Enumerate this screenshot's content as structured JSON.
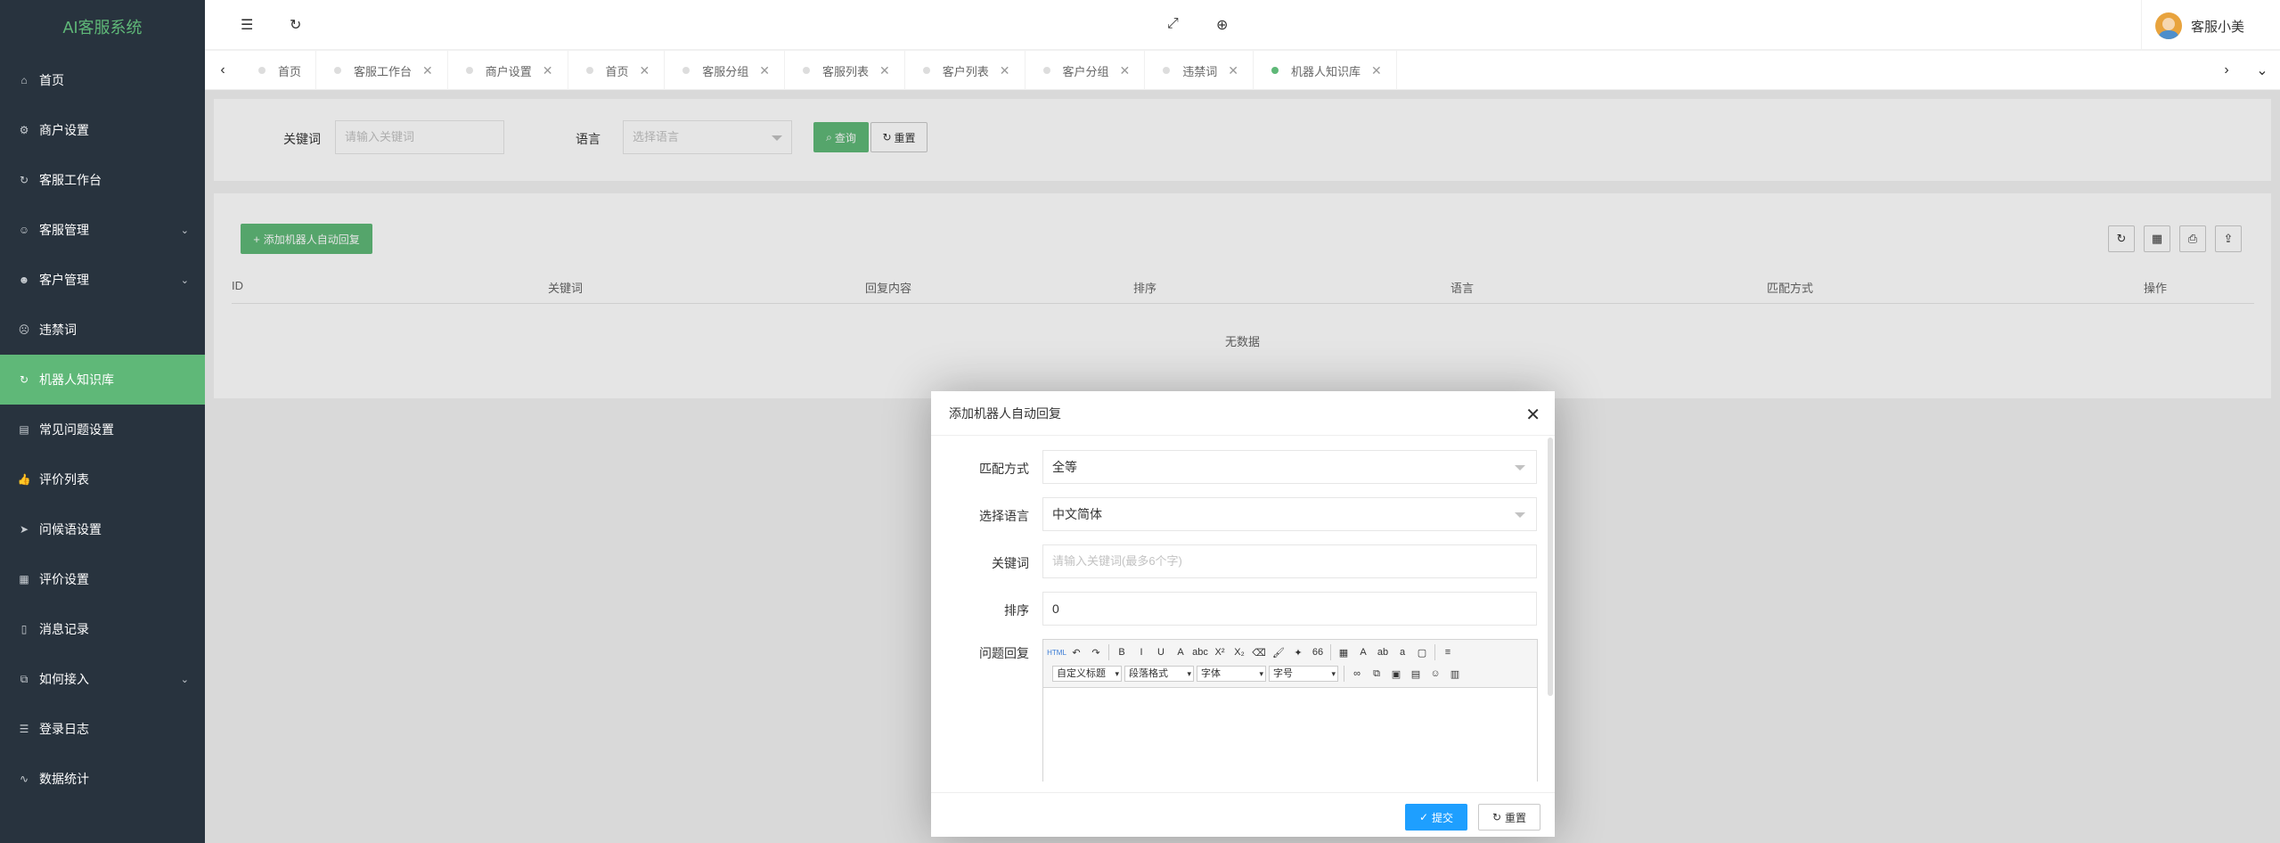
{
  "app": {
    "title": "AI客服系统"
  },
  "sidebar": {
    "items": [
      {
        "label": "首页",
        "icon": "home-icon",
        "glyph": "⌂",
        "expandable": false,
        "active": false
      },
      {
        "label": "商户设置",
        "icon": "gear-icon",
        "glyph": "⚙",
        "expandable": false,
        "active": false
      },
      {
        "label": "客服工作台",
        "icon": "refresh-icon",
        "glyph": "↻",
        "expandable": false,
        "active": false
      },
      {
        "label": "客服管理",
        "icon": "user-icon",
        "glyph": "☺",
        "expandable": true,
        "active": false
      },
      {
        "label": "客户管理",
        "icon": "users-icon",
        "glyph": "☻",
        "expandable": true,
        "active": false
      },
      {
        "label": "违禁词",
        "icon": "face-icon",
        "glyph": "☹",
        "expandable": false,
        "active": false
      },
      {
        "label": "机器人知识库",
        "icon": "refresh-icon",
        "glyph": "↻",
        "expandable": false,
        "active": true
      },
      {
        "label": "常见问题设置",
        "icon": "doc-icon",
        "glyph": "▤",
        "expandable": false,
        "active": false
      },
      {
        "label": "评价列表",
        "icon": "thumb-icon",
        "glyph": "👍",
        "expandable": false,
        "active": false
      },
      {
        "label": "问候语设置",
        "icon": "send-icon",
        "glyph": "➤",
        "expandable": false,
        "active": false
      },
      {
        "label": "评价设置",
        "icon": "calendar-icon",
        "glyph": "▦",
        "expandable": false,
        "active": false
      },
      {
        "label": "消息记录",
        "icon": "file-icon",
        "glyph": "▯",
        "expandable": false,
        "active": false
      },
      {
        "label": "如何接入",
        "icon": "component-icon",
        "glyph": "⧉",
        "expandable": true,
        "active": false
      },
      {
        "label": "登录日志",
        "icon": "list-icon",
        "glyph": "☰",
        "expandable": false,
        "active": false
      },
      {
        "label": "数据统计",
        "icon": "chart-icon",
        "glyph": "∿",
        "expandable": false,
        "active": false
      }
    ]
  },
  "header": {
    "menu_toggle_glyph": "☰",
    "refresh_glyph": "↻",
    "fullscreen_glyph": "⤢",
    "language_glyph": "⊕",
    "username": "客服小美"
  },
  "tabs": {
    "prev_glyph": "‹",
    "next_glyph": "›",
    "more_glyph": "⌄",
    "close_glyph": "✕",
    "items": [
      {
        "label": "首页",
        "closable": false,
        "active": false
      },
      {
        "label": "客服工作台",
        "closable": true,
        "active": false
      },
      {
        "label": "商户设置",
        "closable": true,
        "active": false
      },
      {
        "label": "首页",
        "closable": true,
        "active": false
      },
      {
        "label": "客服分组",
        "closable": true,
        "active": false
      },
      {
        "label": "客服列表",
        "closable": true,
        "active": false
      },
      {
        "label": "客户列表",
        "closable": true,
        "active": false
      },
      {
        "label": "客户分组",
        "closable": true,
        "active": false
      },
      {
        "label": "违禁词",
        "closable": true,
        "active": false
      },
      {
        "label": "机器人知识库",
        "closable": true,
        "active": true
      }
    ]
  },
  "search": {
    "keyword_label": "关键词",
    "keyword_placeholder": "请输入关键词",
    "language_label": "语言",
    "language_placeholder": "选择语言",
    "query_button": "查询",
    "reset_button": "重置"
  },
  "table": {
    "add_button": "添加机器人自动回复",
    "columns": [
      "ID",
      "关键词",
      "回复内容",
      "排序",
      "语言",
      "匹配方式",
      "操作"
    ],
    "empty_text": "无数据",
    "tools": {
      "refresh": "↻",
      "columns": "▦",
      "print": "⎙",
      "export": "⇪"
    }
  },
  "modal": {
    "title": "添加机器人自动回复",
    "close_glyph": "✕",
    "match_label": "匹配方式",
    "match_value": "全等",
    "lang_label": "选择语言",
    "lang_value": "中文简体",
    "keyword_label": "关键词",
    "keyword_placeholder": "请输入关键词(最多6个字)",
    "sort_label": "排序",
    "sort_value": "0",
    "reply_label": "问题回复",
    "editor": {
      "toolbar_row1": [
        "HTML",
        "↶",
        "↷",
        "B",
        "I",
        "U",
        "A",
        "abc",
        "X²",
        "X₂",
        "⌫",
        "🖌",
        "✦",
        "66",
        "▦",
        "A",
        "ab",
        "a",
        "▢",
        "≡"
      ],
      "selects": [
        "自定义标题",
        "段落格式",
        "字体",
        "字号"
      ],
      "toolbar_row2_icons": [
        "∞",
        "⧉",
        "▣",
        "▤",
        "☺",
        "▥"
      ]
    },
    "submit_button": "提交",
    "reset_button": "重置"
  },
  "colors": {
    "sidebar_bg": "#28333e",
    "accent_green": "#5fb878",
    "submit_blue": "#1e9fff"
  }
}
